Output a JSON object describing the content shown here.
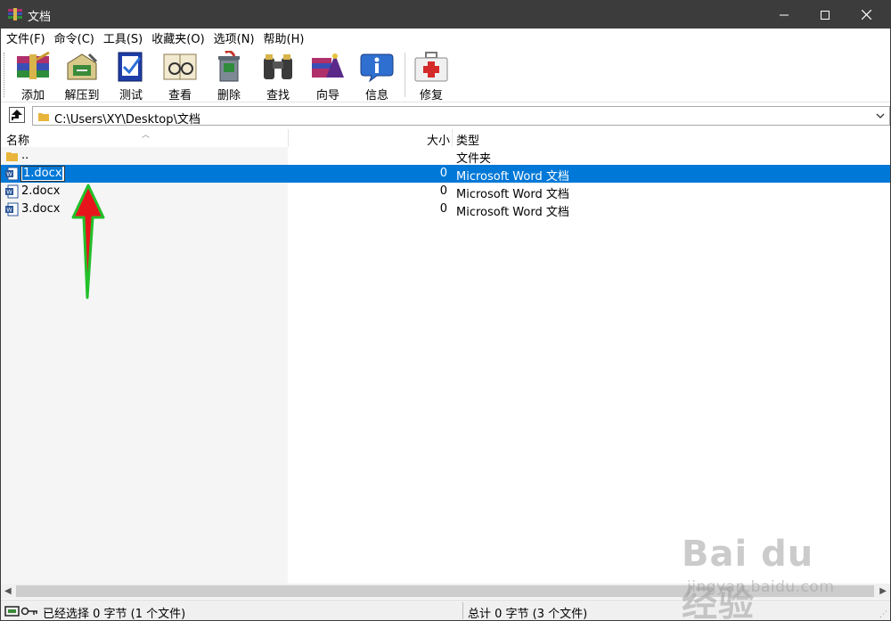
{
  "window": {
    "title": "文档"
  },
  "menu": [
    "文件(F)",
    "命令(C)",
    "工具(S)",
    "收藏夹(O)",
    "选项(N)",
    "帮助(H)"
  ],
  "toolbar": {
    "add": "添加",
    "extract": "解压到",
    "test": "测试",
    "view": "查看",
    "delete": "删除",
    "find": "查找",
    "wizard": "向导",
    "info": "信息",
    "repair": "修复"
  },
  "address": {
    "path": "C:\\Users\\XY\\Desktop\\文档"
  },
  "columns": {
    "name": "名称",
    "size": "大小",
    "type": "类型"
  },
  "rows": [
    {
      "name": "..",
      "size": "",
      "type": "文件夹",
      "icon": "folder-icon"
    },
    {
      "name": "1.docx",
      "size": "0",
      "type": "Microsoft Word 文档",
      "icon": "word-doc-icon",
      "selected": true,
      "renaming": true
    },
    {
      "name": "2.docx",
      "size": "0",
      "type": "Microsoft Word 文档",
      "icon": "word-doc-icon"
    },
    {
      "name": "3.docx",
      "size": "0",
      "type": "Microsoft Word 文档",
      "icon": "word-doc-icon"
    }
  ],
  "status": {
    "left": "已经选择 0 字节 (1 个文件)",
    "right": "总计 0 字节 (3 个文件)"
  },
  "watermark": {
    "main": "Bai du 经验",
    "sub": "jingyan.baidu.com"
  },
  "colors": {
    "titlebar": "#3c3c3c",
    "selection": "#0078d7",
    "annotation_arrow": "#e8141b",
    "annotation_outline": "#22c02a"
  }
}
